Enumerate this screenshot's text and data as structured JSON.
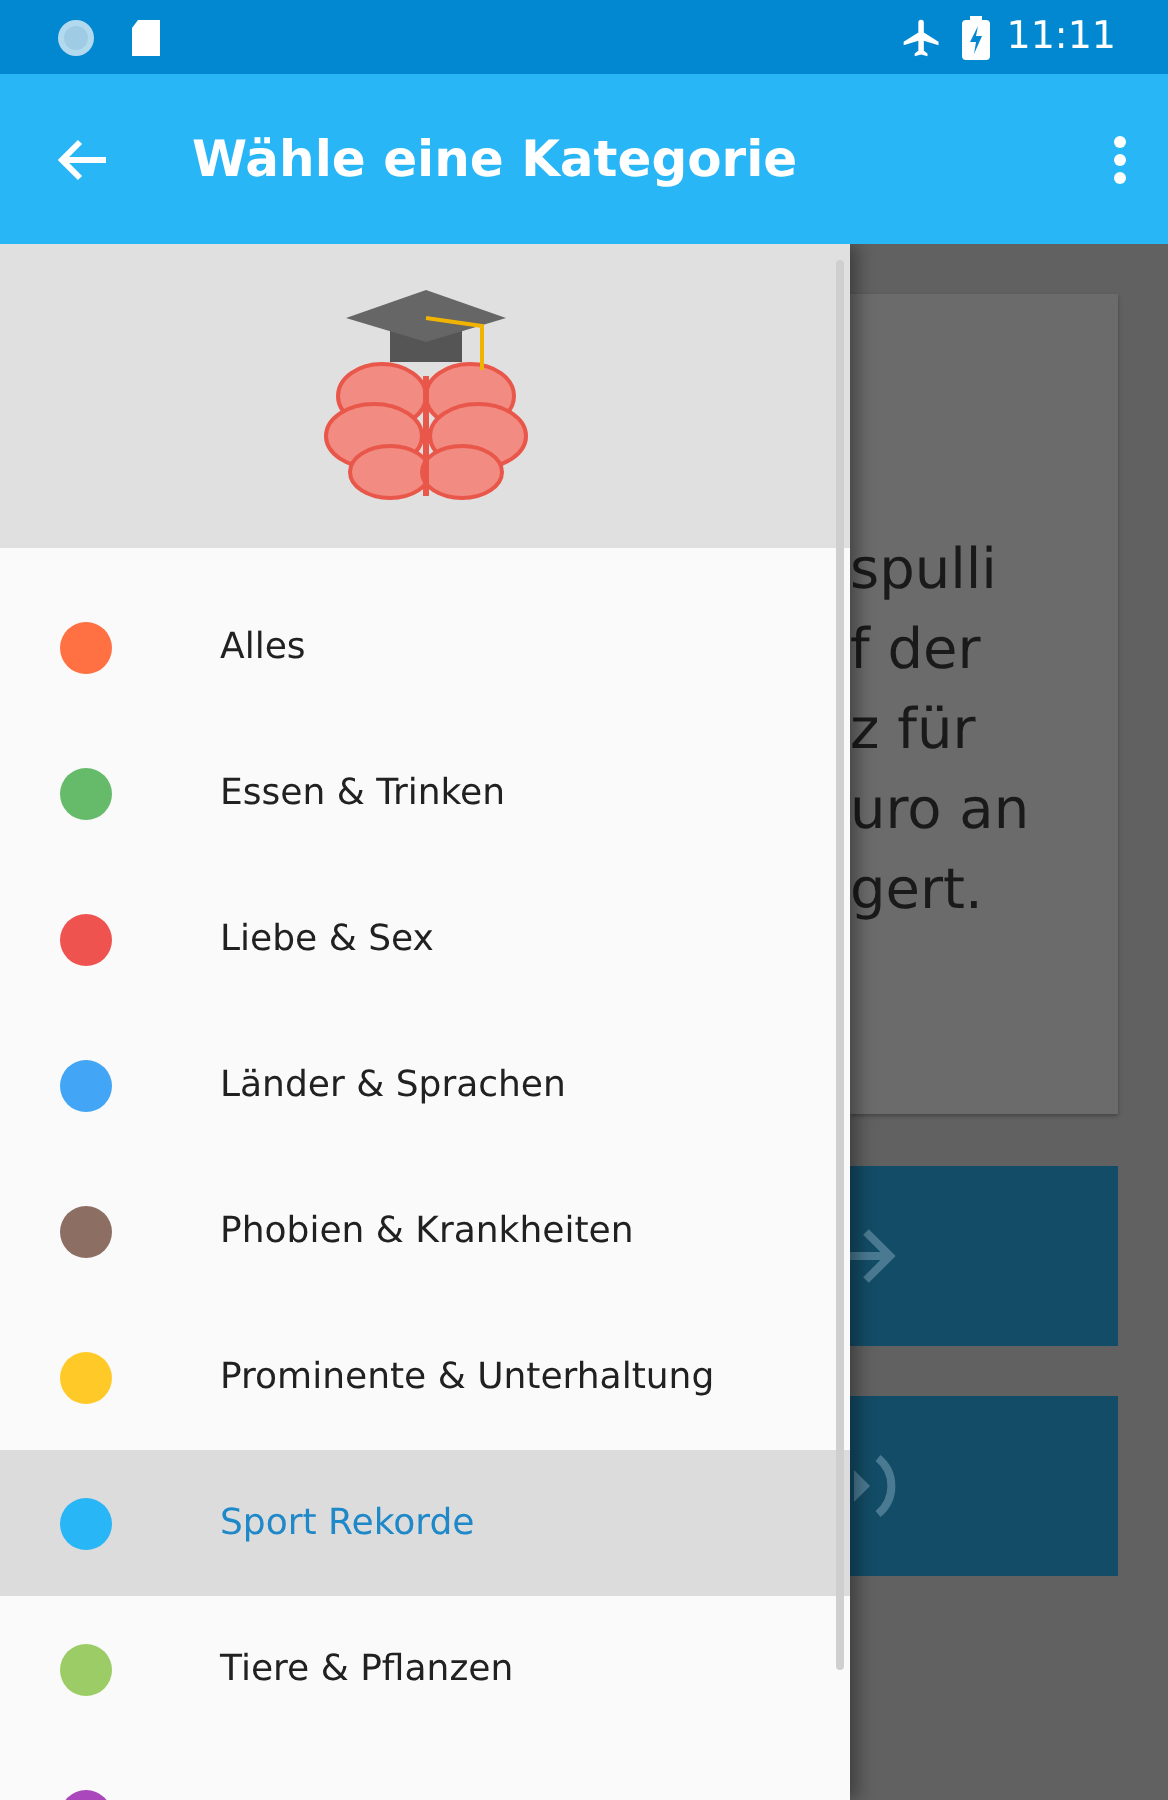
{
  "status_bar": {
    "time": "11:11"
  },
  "app_bar": {
    "title": "Wähle eine Kategorie"
  },
  "background": {
    "card_lines": [
      "spulli",
      "f der",
      "z für",
      "uro an",
      "gert."
    ]
  },
  "drawer": {
    "categories": [
      {
        "label": "Alles",
        "color": "#ff7043",
        "selected": false
      },
      {
        "label": "Essen & Trinken",
        "color": "#66bb6a",
        "selected": false
      },
      {
        "label": "Liebe & Sex",
        "color": "#ef5350",
        "selected": false
      },
      {
        "label": "Länder & Sprachen",
        "color": "#42a5f5",
        "selected": false
      },
      {
        "label": "Phobien & Krankheiten",
        "color": "#8d6e63",
        "selected": false
      },
      {
        "label": "Prominente & Unterhaltung",
        "color": "#ffca28",
        "selected": false
      },
      {
        "label": "Sport Rekorde",
        "color": "#29b6f6",
        "selected": true
      },
      {
        "label": "Tiere & Pflanzen",
        "color": "#9ccc65",
        "selected": false
      },
      {
        "color": "#ab47bc",
        "selected": false
      }
    ]
  }
}
